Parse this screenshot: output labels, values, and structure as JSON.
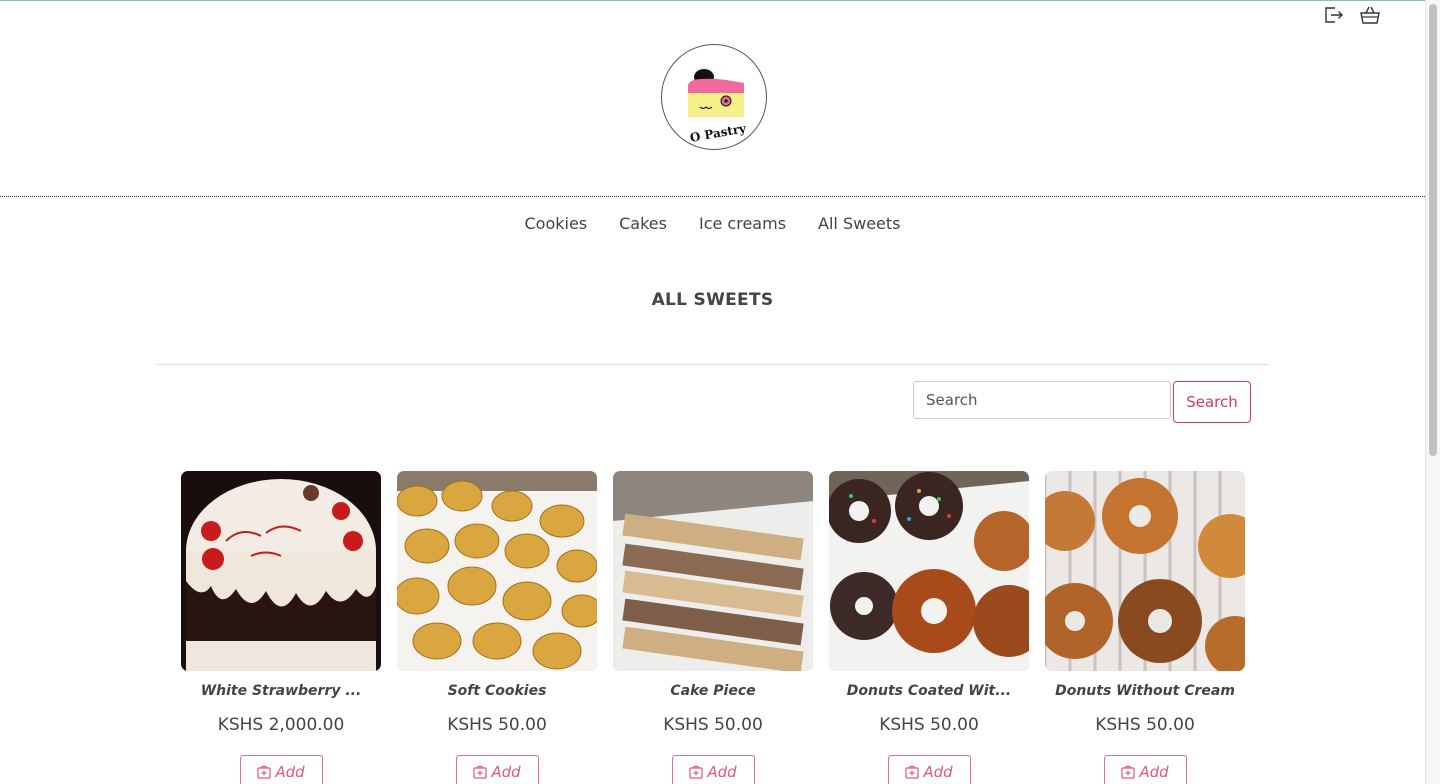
{
  "header": {
    "logo_text": "O    Pastry",
    "logout_icon": "logout-icon",
    "cart_icon": "basket-icon"
  },
  "nav": {
    "items": [
      {
        "label": "Cookies"
      },
      {
        "label": "Cakes"
      },
      {
        "label": "Ice creams"
      },
      {
        "label": "All Sweets"
      }
    ]
  },
  "main": {
    "section_title": "ALL SWEETS",
    "search": {
      "placeholder": "Search",
      "button_label": "Search"
    },
    "products": [
      {
        "name": "White Strawberry ...",
        "price": "KSHS 2,000.00",
        "add_label": "Add"
      },
      {
        "name": "Soft Cookies",
        "price": "KSHS 50.00",
        "add_label": "Add"
      },
      {
        "name": "Cake Piece",
        "price": "KSHS 50.00",
        "add_label": "Add"
      },
      {
        "name": "Donuts Coated Wit...",
        "price": "KSHS 50.00",
        "add_label": "Add"
      },
      {
        "name": "Donuts Without Cream",
        "price": "KSHS 50.00",
        "add_label": "Add"
      }
    ]
  },
  "colors": {
    "accent": "#d63865",
    "text": "#444444",
    "divider": "#dddddd"
  }
}
